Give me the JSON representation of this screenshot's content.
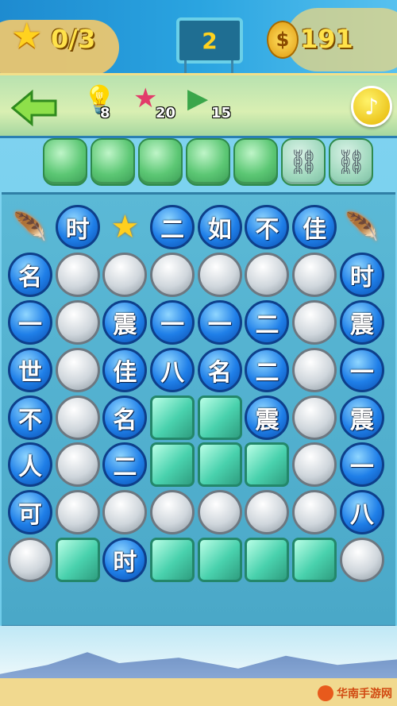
{
  "header": {
    "goal_progress": "0/3",
    "level": "2",
    "coins": "191"
  },
  "powerups": {
    "hint_count": "8",
    "star_count": "20",
    "triangle_count": "15"
  },
  "answer_slots": [
    {
      "state": "empty"
    },
    {
      "state": "empty"
    },
    {
      "state": "empty"
    },
    {
      "state": "empty"
    },
    {
      "state": "empty"
    },
    {
      "state": "locked"
    },
    {
      "state": "locked"
    }
  ],
  "board": [
    [
      {
        "t": "feather",
        "c": ""
      },
      {
        "t": "blue",
        "c": "时"
      },
      {
        "t": "staritem",
        "c": ""
      },
      {
        "t": "blue",
        "c": "二"
      },
      {
        "t": "blue",
        "c": "如"
      },
      {
        "t": "blue",
        "c": "不"
      },
      {
        "t": "blue",
        "c": "佳"
      },
      {
        "t": "feather",
        "c": ""
      }
    ],
    [
      {
        "t": "blue",
        "c": "名"
      },
      {
        "t": "gray",
        "c": ""
      },
      {
        "t": "gray",
        "c": ""
      },
      {
        "t": "gray",
        "c": ""
      },
      {
        "t": "gray",
        "c": ""
      },
      {
        "t": "gray",
        "c": ""
      },
      {
        "t": "gray",
        "c": ""
      },
      {
        "t": "blue",
        "c": "时"
      }
    ],
    [
      {
        "t": "blue",
        "c": "一"
      },
      {
        "t": "gray",
        "c": ""
      },
      {
        "t": "blue",
        "c": "震"
      },
      {
        "t": "blue",
        "c": "一"
      },
      {
        "t": "blue",
        "c": "一"
      },
      {
        "t": "blue",
        "c": "二"
      },
      {
        "t": "gray",
        "c": ""
      },
      {
        "t": "blue",
        "c": "震"
      }
    ],
    [
      {
        "t": "blue",
        "c": "世"
      },
      {
        "t": "gray",
        "c": ""
      },
      {
        "t": "blue",
        "c": "佳"
      },
      {
        "t": "blue",
        "c": "八"
      },
      {
        "t": "blue",
        "c": "名"
      },
      {
        "t": "blue",
        "c": "二"
      },
      {
        "t": "gray",
        "c": ""
      },
      {
        "t": "blue",
        "c": "一"
      }
    ],
    [
      {
        "t": "blue",
        "c": "不"
      },
      {
        "t": "gray",
        "c": ""
      },
      {
        "t": "blue",
        "c": "名"
      },
      {
        "t": "jade",
        "c": ""
      },
      {
        "t": "jade",
        "c": ""
      },
      {
        "t": "blue",
        "c": "震"
      },
      {
        "t": "gray",
        "c": ""
      },
      {
        "t": "blue",
        "c": "震"
      }
    ],
    [
      {
        "t": "blue",
        "c": "人"
      },
      {
        "t": "gray",
        "c": ""
      },
      {
        "t": "blue",
        "c": "二"
      },
      {
        "t": "jade",
        "c": ""
      },
      {
        "t": "jade",
        "c": ""
      },
      {
        "t": "jade",
        "c": ""
      },
      {
        "t": "gray",
        "c": ""
      },
      {
        "t": "blue",
        "c": "一"
      }
    ],
    [
      {
        "t": "blue",
        "c": "可"
      },
      {
        "t": "gray",
        "c": ""
      },
      {
        "t": "gray",
        "c": ""
      },
      {
        "t": "gray",
        "c": ""
      },
      {
        "t": "gray",
        "c": ""
      },
      {
        "t": "gray",
        "c": ""
      },
      {
        "t": "gray",
        "c": ""
      },
      {
        "t": "blue",
        "c": "八"
      }
    ],
    [
      {
        "t": "gray",
        "c": ""
      },
      {
        "t": "jade",
        "c": ""
      },
      {
        "t": "blue",
        "c": "时"
      },
      {
        "t": "jade",
        "c": ""
      },
      {
        "t": "jade",
        "c": ""
      },
      {
        "t": "jade",
        "c": ""
      },
      {
        "t": "jade",
        "c": ""
      },
      {
        "t": "gray",
        "c": ""
      }
    ]
  ],
  "watermark": "华南手游网",
  "icons": {
    "star": "★",
    "coin": "$",
    "back": "back-arrow-icon",
    "bulb": "bulb-icon",
    "music": "♪",
    "chain": "chain-lock-icon"
  }
}
